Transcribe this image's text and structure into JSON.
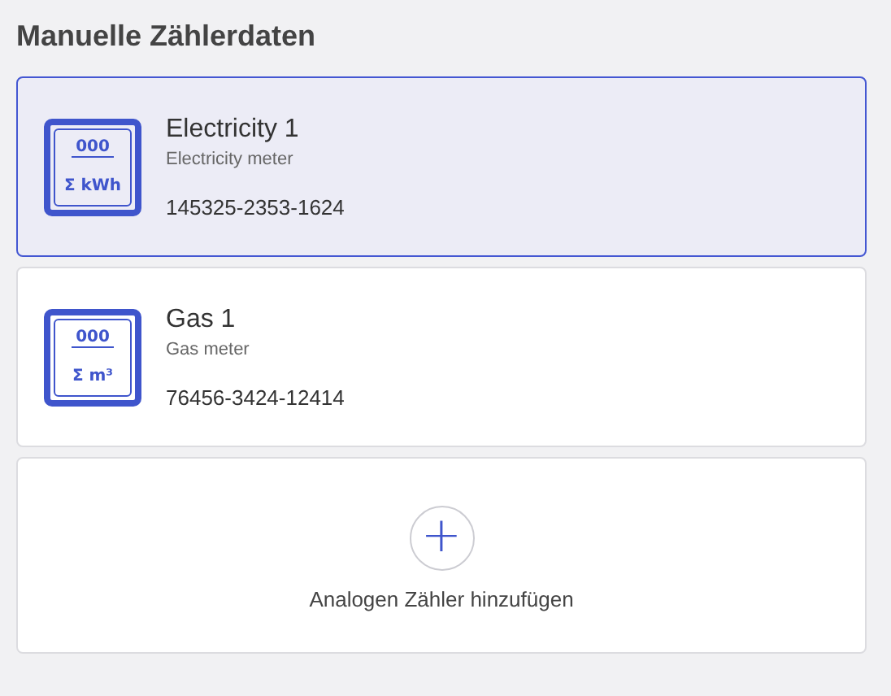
{
  "title": "Manuelle Zählerdaten",
  "meters": [
    {
      "name": "Electricity 1",
      "type": "Electricity meter",
      "number": "145325-2353-1624",
      "icon_digits": "000",
      "icon_unit": "Σ kWh",
      "selected": true
    },
    {
      "name": "Gas 1",
      "type": "Gas meter",
      "number": "76456-3424-12414",
      "icon_digits": "000",
      "icon_unit": "Σ m³",
      "selected": false
    }
  ],
  "add": {
    "icon": "+",
    "label": "Analogen Zähler hinzufügen"
  }
}
